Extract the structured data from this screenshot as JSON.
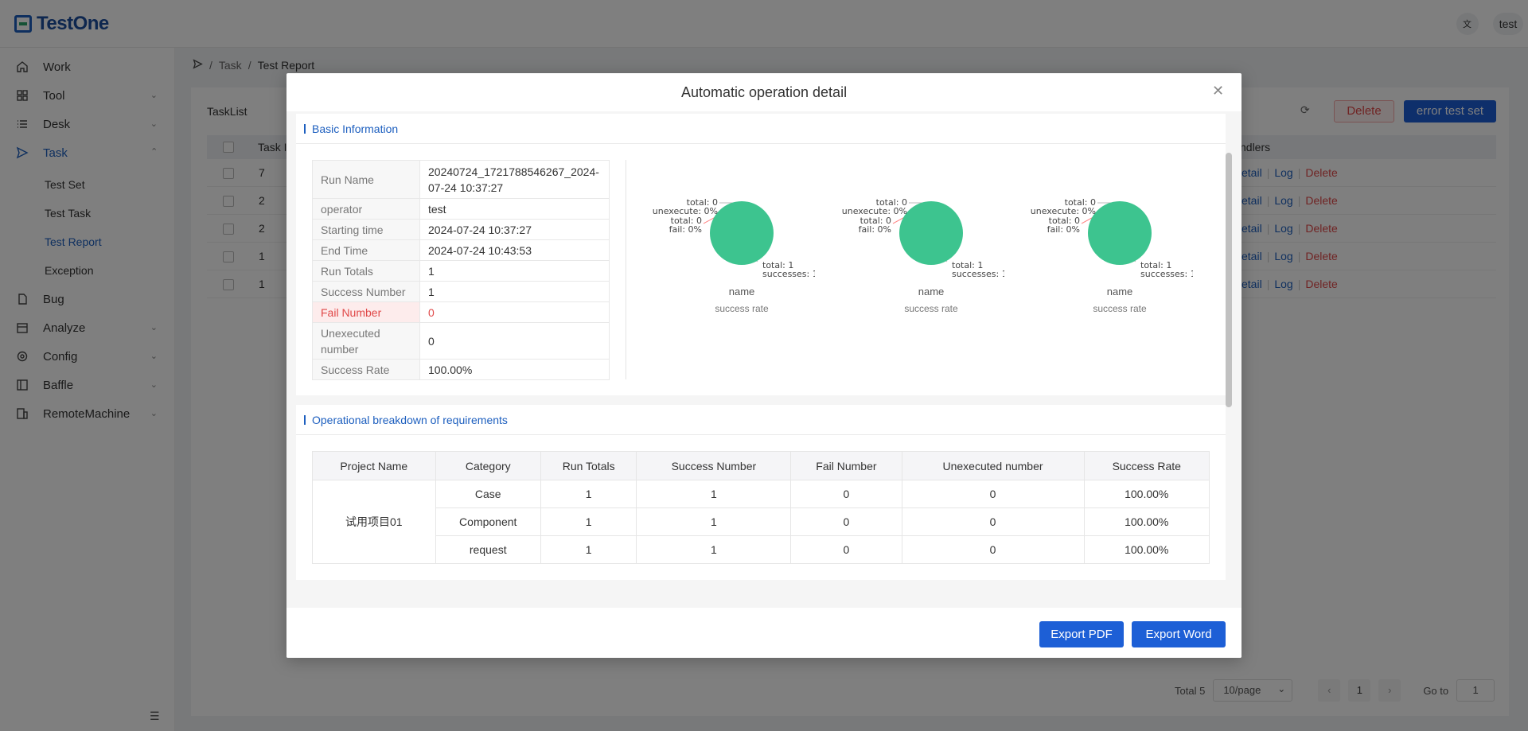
{
  "app": {
    "logo_text": "TestOne",
    "user": "test",
    "lang_icon": "translate-icon"
  },
  "sidebar": {
    "items": [
      {
        "label": "Work",
        "icon": "home-icon"
      },
      {
        "label": "Tool",
        "icon": "grid-icon"
      },
      {
        "label": "Desk",
        "icon": "list-icon"
      },
      {
        "label": "Task",
        "icon": "send-icon"
      },
      {
        "label": "Bug",
        "icon": "file-icon"
      },
      {
        "label": "Analyze",
        "icon": "calendar-icon"
      },
      {
        "label": "Config",
        "icon": "gear-icon"
      },
      {
        "label": "Baffle",
        "icon": "panel-icon"
      },
      {
        "label": "RemoteMachine",
        "icon": "machine-icon"
      }
    ],
    "task_children": [
      "Test Set",
      "Test Task",
      "Test Report",
      "Exception"
    ]
  },
  "breadcrumb": {
    "level1": "Task",
    "level2": "Test Report"
  },
  "list": {
    "title": "TaskList",
    "delete_label": "Delete",
    "error_set_label": "error test set",
    "col_task": "Task I",
    "col_handlers": "ndlers",
    "rows": [
      "7",
      "2",
      "2",
      "1",
      "1"
    ],
    "op_detail": "etail",
    "op_log": "Log",
    "op_delete": "Delete"
  },
  "pagination": {
    "total": "Total 5",
    "page_size": "10/page",
    "current": "1",
    "goto_label": "Go to",
    "goto_value": "1"
  },
  "modal": {
    "title": "Automatic operation detail",
    "basic_section": "Basic Information",
    "req_section": "Operational breakdown of requirements",
    "basic_info": [
      {
        "k": "Run Name",
        "v": "20240724_1721788546267_2024-07-24 10:37:27"
      },
      {
        "k": "operator",
        "v": "test"
      },
      {
        "k": "Starting time",
        "v": "2024-07-24 10:37:27"
      },
      {
        "k": "End Time",
        "v": "2024-07-24 10:43:53"
      },
      {
        "k": "Run Totals",
        "v": "1"
      },
      {
        "k": "Success Number",
        "v": "1"
      },
      {
        "k": "Fail Number",
        "v": "0"
      },
      {
        "k": "Unexecuted number",
        "v": "0"
      },
      {
        "k": "Success Rate",
        "v": "100.00%"
      }
    ],
    "pie_labels": {
      "total0": "total: 0",
      "unexecute": "unexecute: 0%",
      "total0b": "total: 0",
      "fail": "fail: 0%",
      "total1": "total: 1",
      "successes": "successes: 1..."
    },
    "pie_name": "name",
    "pie_sub": "success rate",
    "pie_color": "#3dc48f",
    "req_table": {
      "headers": [
        "Project Name",
        "Category",
        "Run Totals",
        "Success Number",
        "Fail Number",
        "Unexecuted number",
        "Success Rate"
      ],
      "project": "试用项目01",
      "rows": [
        [
          "Case",
          "1",
          "1",
          "0",
          "0",
          "100.00%"
        ],
        [
          "Component",
          "1",
          "1",
          "0",
          "0",
          "100.00%"
        ],
        [
          "request",
          "1",
          "1",
          "0",
          "0",
          "100.00%"
        ]
      ]
    },
    "export_pdf": "Export PDF",
    "export_word": "Export Word"
  }
}
